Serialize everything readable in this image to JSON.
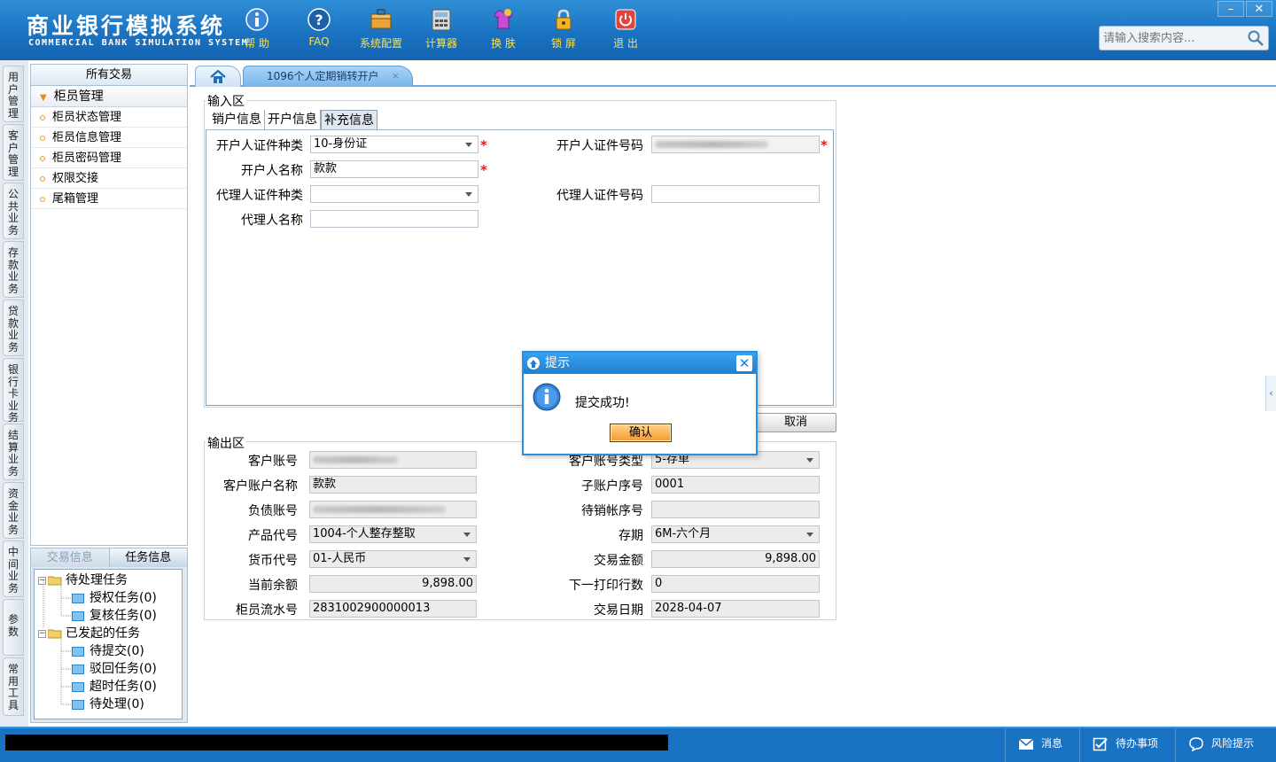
{
  "header": {
    "brand_cn": "商业银行模拟系统",
    "brand_en": "COMMERCIAL BANK SIMULATION SYSTEM",
    "tools": [
      {
        "label": "帮 助",
        "icon": "info-icon"
      },
      {
        "label": "FAQ",
        "icon": "help-icon"
      },
      {
        "label": "系统配置",
        "icon": "toolbox-icon"
      },
      {
        "label": "计算器",
        "icon": "calculator-icon"
      },
      {
        "label": "换 肤",
        "icon": "shirt-icon"
      },
      {
        "label": "锁 屏",
        "icon": "lock-icon"
      },
      {
        "label": "退 出",
        "icon": "power-icon"
      }
    ],
    "search_placeholder": "请输入搜索内容...",
    "window_controls": [
      "–",
      "✕"
    ]
  },
  "vnav": [
    "用户管理",
    "客户管理",
    "公共业务",
    "存款业务",
    "贷款业务",
    "银行卡业务",
    "结算业务",
    "资金业务",
    "中间业务",
    "参数",
    "常用工具"
  ],
  "menu": {
    "title": "所有交易",
    "group": "柜员管理",
    "items": [
      "柜员状态管理",
      "柜员信息管理",
      "柜员密码管理",
      "权限交接",
      "尾箱管理"
    ]
  },
  "task_panel": {
    "tabs": [
      "交易信息",
      "任务信息"
    ],
    "tree": [
      {
        "label": "待处理任务",
        "level": 0
      },
      {
        "label": "授权任务(0)",
        "level": 1
      },
      {
        "label": "复核任务(0)",
        "level": 1
      },
      {
        "label": "已发起的任务",
        "level": 0
      },
      {
        "label": "待提交(0)",
        "level": 1
      },
      {
        "label": "驳回任务(0)",
        "level": 1
      },
      {
        "label": "超时任务(0)",
        "level": 1
      },
      {
        "label": "待处理(0)",
        "level": 1
      }
    ]
  },
  "tabs": {
    "current": "1096个人定期销转开户",
    "close": "×"
  },
  "input_area": {
    "legend": "输入区",
    "subtabs": [
      "销户信息",
      "开户信息",
      "补充信息"
    ],
    "fields": {
      "id_type_label": "开户人证件种类",
      "id_type_value": "10-身份证",
      "id_no_label": "开户人证件号码",
      "name_label": "开户人名称",
      "name_value": "款款",
      "agent_id_type_label": "代理人证件种类",
      "agent_id_type_value": "",
      "agent_id_no_label": "代理人证件号码",
      "agent_id_no_value": "",
      "agent_name_label": "代理人名称",
      "agent_name_value": ""
    },
    "required_mark": "*",
    "cancel": "取消"
  },
  "output_area": {
    "legend": "输出区",
    "fields": {
      "acct_label": "客户账号",
      "acct_type_label": "客户账号类型",
      "acct_type_value": "5-存单",
      "acct_name_label": "客户账户名称",
      "acct_name_value": "款款",
      "sub_seq_label": "子账户序号",
      "sub_seq_value": "0001",
      "liab_label": "负债账号",
      "pending_label": "待销帐序号",
      "pending_value": "",
      "product_label": "产品代号",
      "product_value": "1004-个人整存整取",
      "term_label": "存期",
      "term_value": "6M-六个月",
      "currency_label": "货币代号",
      "currency_value": "01-人民币",
      "amount_label": "交易金额",
      "amount_value": "9,898.00",
      "balance_label": "当前余额",
      "balance_value": "9,898.00",
      "next_print_label": "下一打印行数",
      "next_print_value": "0",
      "teller_seq_label": "柜员流水号",
      "teller_seq_value": "2831002900000013",
      "tx_date_label": "交易日期",
      "tx_date_value": "2028-04-07"
    }
  },
  "dialog": {
    "title": "提示",
    "message": "提交成功!",
    "ok": "确认",
    "close": "✕"
  },
  "statusbar": {
    "items": [
      {
        "label": "消息",
        "icon": "mail-icon"
      },
      {
        "label": "待办事项",
        "icon": "checkbox-icon"
      },
      {
        "label": "风险提示",
        "icon": "chat-icon"
      }
    ]
  },
  "side_handle": "‹"
}
